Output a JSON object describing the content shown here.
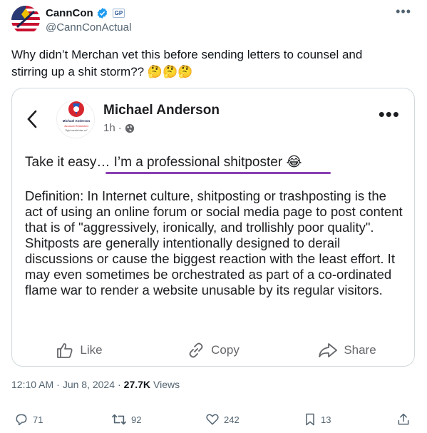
{
  "author": {
    "display_name": "CannCon",
    "handle": "@CannConActual",
    "badge_text": "GP"
  },
  "tweet": {
    "text": "Why didn’t Merchan vet this before sending letters to counsel and stirring up a shit storm?? 🤔🤔🤔"
  },
  "embed": {
    "author_name": "Michael Anderson",
    "time_ago": "1h",
    "avatar_caption_top": "Michael Anderson",
    "avatar_caption_mid": "Account Restricted",
    "avatar_caption_bottom": "\"fight media bias co\"",
    "line1": "Take it easy… I’m a professional shitposter 😂",
    "definition": "Definition: In Internet culture, shitposting or trashposting is the act of using an online forum or social media page to post content that is of \"aggressively, ironically, and trollishly poor quality\". Shitposts are generally intentionally designed to derail discussions or cause the biggest reaction with the least effort. It may even sometimes be orchestrated as part of a co-ordinated flame war to render a website unusable by its regular visitors.",
    "actions": {
      "like": "Like",
      "copy": "Copy",
      "share": "Share"
    }
  },
  "meta": {
    "time": "12:10 AM",
    "date": "Jun 8, 2024",
    "views_count": "27.7K",
    "views_label": "Views"
  },
  "stats": {
    "replies": "71",
    "reposts": "92",
    "likes": "242",
    "bookmarks": "13"
  },
  "colors": {
    "accent": "#1d9bf0",
    "underline": "#8b3fb3",
    "muted": "#536471"
  }
}
